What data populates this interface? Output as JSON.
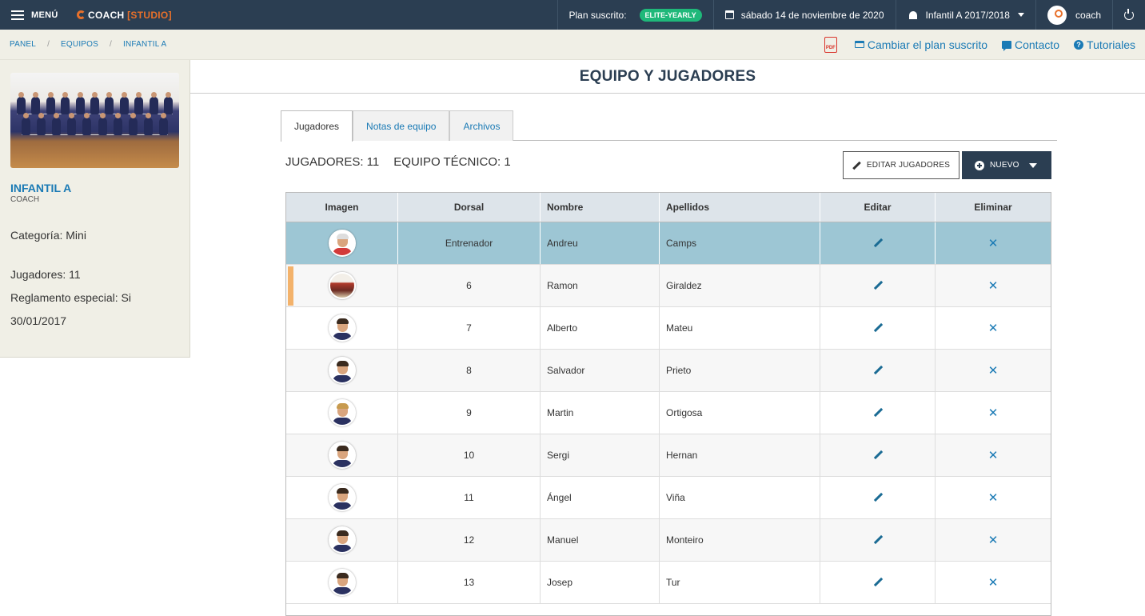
{
  "topbar": {
    "menu_label": "MENÚ",
    "logo_text": "COACH",
    "logo_bracket": "[STUDIO]",
    "plan_label": "Plan suscrito:",
    "plan_badge": "ELITE-YEARLY",
    "date": "sábado 14 de noviembre de 2020",
    "team_selector": "Infantil A 2017/2018",
    "user": "coach",
    "colors": {
      "bar": "#2b3e52",
      "badge": "#1fb87a",
      "accent": "#e8702a"
    }
  },
  "breadcrumb": {
    "items": [
      "PANEL",
      "EQUIPOS",
      "INFANTIL A"
    ],
    "separator": "/",
    "pdf_label": "PDF",
    "links": {
      "change_plan": "Cambiar el plan suscrito",
      "contact": "Contacto",
      "tutorials": "Tutoriales"
    }
  },
  "sidebar": {
    "team_name": "INFANTIL A",
    "role": "COACH",
    "category": "Categoría: Mini",
    "players": "Jugadores: 11",
    "special_rules": "Reglamento especial: Si",
    "date": "30/01/2017"
  },
  "main": {
    "title": "EQUIPO Y JUGADORES",
    "tabs": [
      {
        "label": "Jugadores",
        "active": true
      },
      {
        "label": "Notas de equipo",
        "active": false
      },
      {
        "label": "Archivos",
        "active": false
      }
    ],
    "players_count": "JUGADORES: 11",
    "staff_count": "EQUIPO TÉCNICO: 1",
    "edit_button": "EDITAR JUGADORES",
    "new_button": "NUEVO"
  },
  "table": {
    "headers": [
      "Imagen",
      "Dorsal",
      "Nombre",
      "Apellidos",
      "Editar",
      "Eliminar"
    ],
    "rows": [
      {
        "dorsal": "Entrenador",
        "nombre": "Andreu",
        "apellidos": "Camps",
        "photo": "coach-photo",
        "selected": true
      },
      {
        "dorsal": "6",
        "nombre": "Ramon",
        "apellidos": "Giraldez",
        "photo": "team-photo-thumb",
        "marked": true
      },
      {
        "dorsal": "7",
        "nombre": "Alberto",
        "apellidos": "Mateu",
        "photo": "player-photo"
      },
      {
        "dorsal": "8",
        "nombre": "Salvador",
        "apellidos": "Prieto",
        "photo": "player-photo"
      },
      {
        "dorsal": "9",
        "nombre": "Martin",
        "apellidos": "Ortigosa",
        "photo": "player-photo"
      },
      {
        "dorsal": "10",
        "nombre": "Sergi",
        "apellidos": "Hernan",
        "photo": "player-photo"
      },
      {
        "dorsal": "11",
        "nombre": "Ángel",
        "apellidos": "Viña",
        "photo": "player-photo"
      },
      {
        "dorsal": "12",
        "nombre": "Manuel",
        "apellidos": "Monteiro",
        "photo": "player-photo"
      },
      {
        "dorsal": "13",
        "nombre": "Josep",
        "apellidos": "Tur",
        "photo": "player-photo"
      }
    ],
    "edit_icon": "pencil-icon",
    "delete_icon": "close-icon",
    "delete_glyph": "✕"
  }
}
